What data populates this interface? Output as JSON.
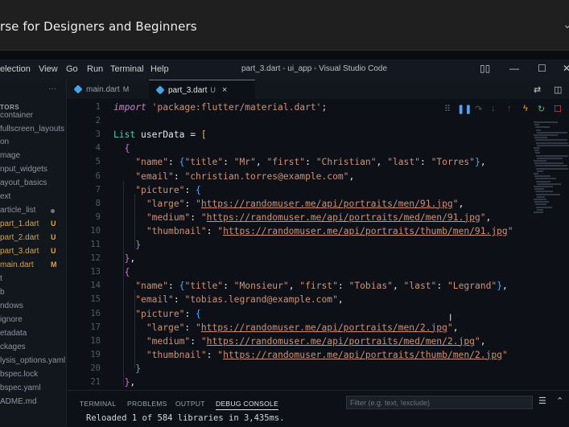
{
  "course": {
    "title": "rse for Designers and Beginners"
  },
  "titlebar": {
    "menu": [
      "election",
      "View",
      "Go",
      "Run",
      "Terminal",
      "Help"
    ],
    "window_title": "part_3.dart - ui_app - Visual Studio Code"
  },
  "sidebar": {
    "header": "TORS",
    "items": [
      {
        "label": "container"
      },
      {
        "label": "fullscreen_layouts"
      },
      {
        "label": "on"
      },
      {
        "label": "mage"
      },
      {
        "label": "nput_widgets"
      },
      {
        "label": "ayout_basics"
      },
      {
        "label": "ext"
      },
      {
        "label": "article_list"
      },
      {
        "label": "part_1.dart",
        "badge": "U"
      },
      {
        "label": "part_2.dart",
        "badge": "U"
      },
      {
        "label": "part_3.dart",
        "badge": "U"
      },
      {
        "label": "main.dart",
        "badge": "M"
      },
      {
        "label": "t"
      },
      {
        "label": "b"
      },
      {
        "label": "ndows"
      },
      {
        "label": "ignore"
      },
      {
        "label": "etadata"
      },
      {
        "label": "ckages"
      },
      {
        "label": "lysis_options.yaml"
      },
      {
        "label": "bspec.lock"
      },
      {
        "label": "bspec.yaml"
      },
      {
        "label": "ADME.md"
      }
    ]
  },
  "tabs": [
    {
      "label": "main.dart",
      "badge": "M"
    },
    {
      "label": "part_3.dart",
      "badge": "U",
      "close": "×"
    }
  ],
  "editor": {
    "line_numbers": [
      "1",
      "2",
      "3",
      "4",
      "5",
      "6",
      "7",
      "8",
      "9",
      "10",
      "11",
      "12",
      "13",
      "14",
      "15",
      "16",
      "17",
      "18",
      "19",
      "20",
      "21"
    ]
  },
  "panel": {
    "tabs": [
      "TERMINAL",
      "PROBLEMS",
      "OUTPUT",
      "DEBUG CONSOLE"
    ],
    "filter_placeholder": "Filter (e.g. text, !exclude)",
    "output": "Reloaded 1 of 584 libraries in 3,435ms."
  },
  "colors": {
    "accent": "#3a7bd5",
    "string": "#ce9178",
    "keyword": "#c586c0",
    "type": "#4ec9b0"
  }
}
